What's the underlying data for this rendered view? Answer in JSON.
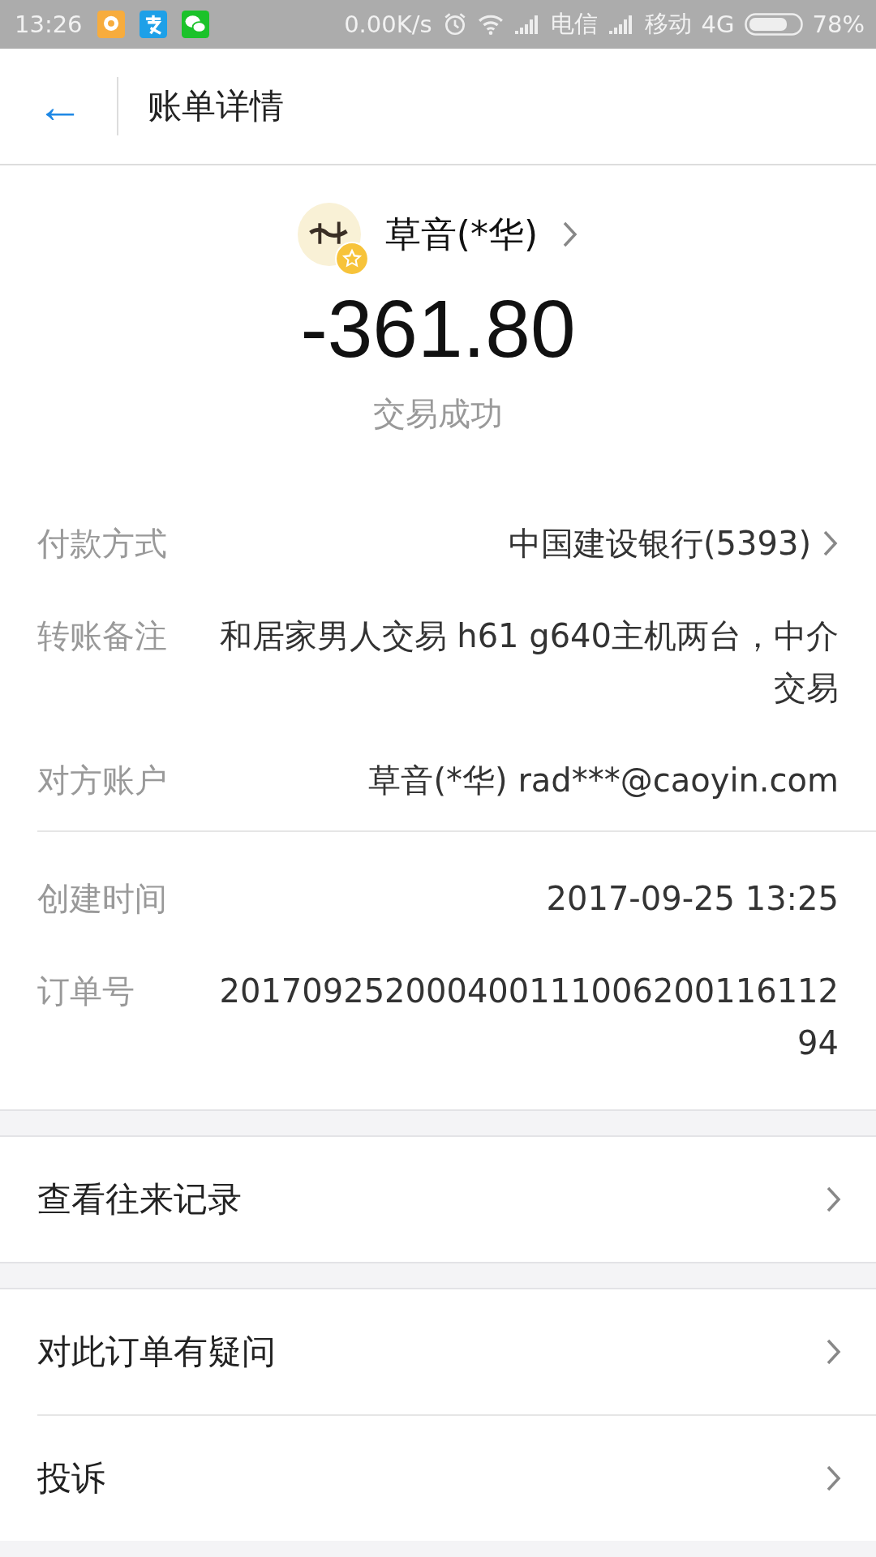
{
  "status_bar": {
    "time": "13:26",
    "speed": "0.00K/s",
    "carrier_1": "电信",
    "carrier_2": "移动",
    "network": "4G",
    "battery": "78%"
  },
  "header": {
    "back": "←",
    "title": "账单详情"
  },
  "summary": {
    "payee": "草音(*华)",
    "amount": "-361.80",
    "status": "交易成功"
  },
  "details": [
    {
      "label": "付款方式",
      "value": "中国建设银行(5393)",
      "link": true
    },
    {
      "label": "转账备注",
      "value": "和居家男人交易 h61 g640主机两台，中介交易",
      "link": false
    },
    {
      "label": "对方账户",
      "value": "草音(*华) rad***@caoyin.com",
      "link": false
    }
  ],
  "details_2": [
    {
      "label": "创建时间",
      "value": "2017-09-25 13:25"
    },
    {
      "label": "订单号",
      "value": "20170925200040011100620011611294"
    }
  ],
  "action_groups": [
    [
      {
        "label": "查看往来记录"
      }
    ],
    [
      {
        "label": "对此订单有疑问"
      },
      {
        "label": "投诉"
      }
    ]
  ]
}
